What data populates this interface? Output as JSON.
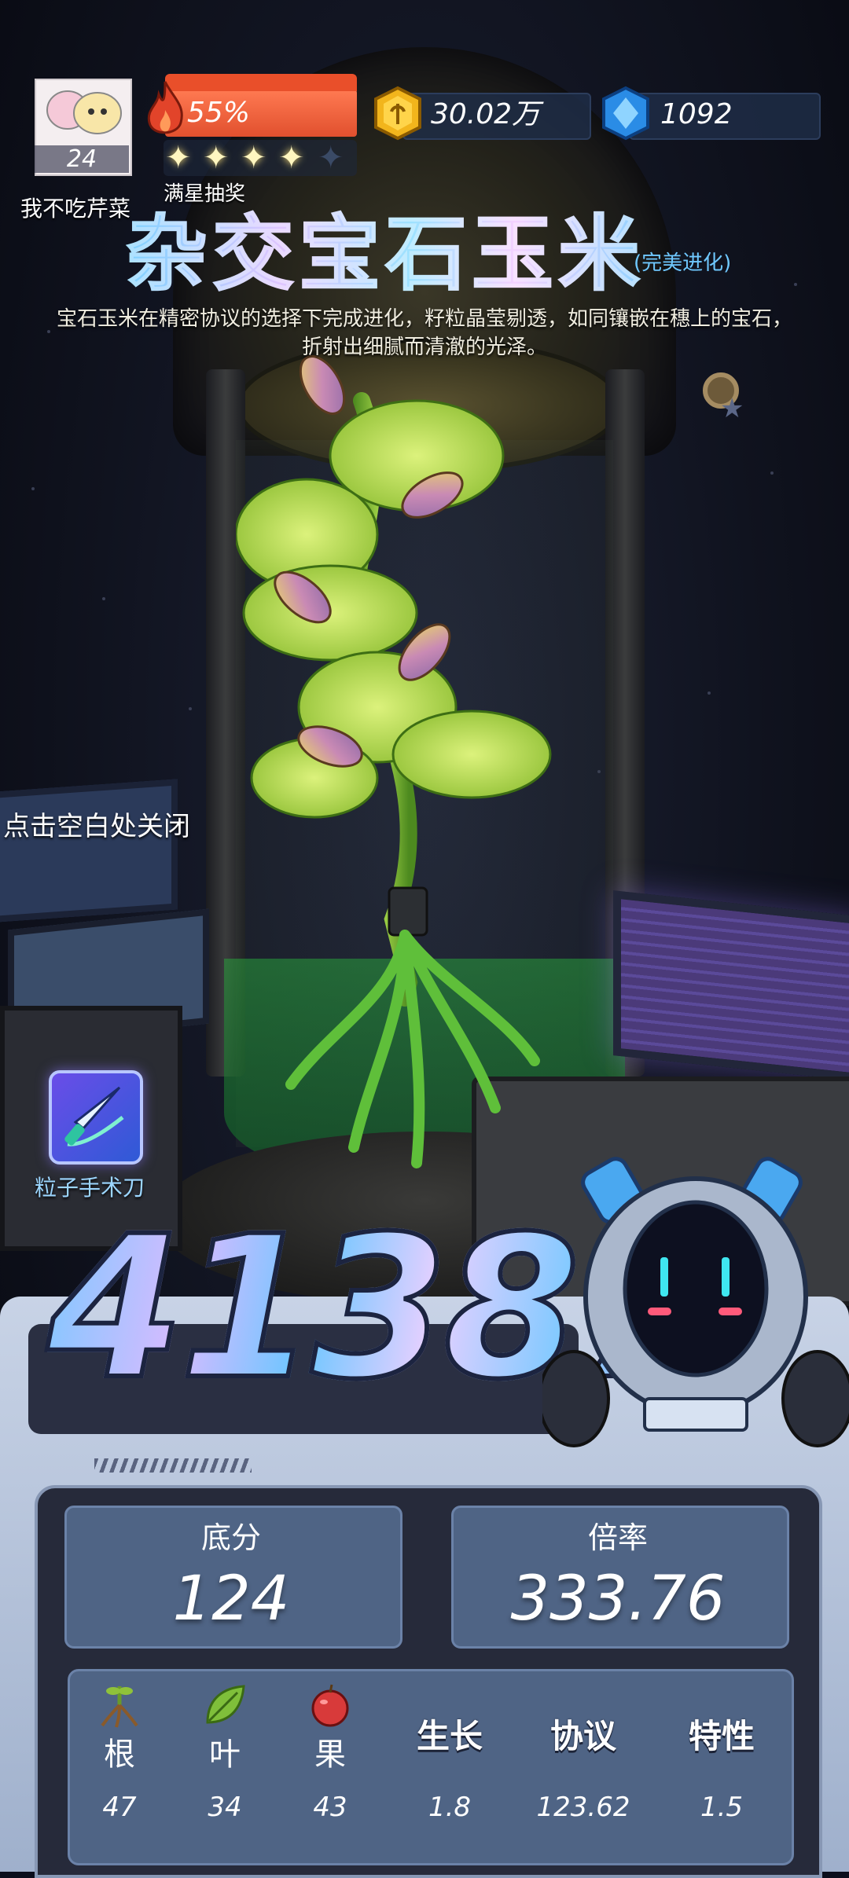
{
  "player": {
    "name": "我不吃芹菜",
    "level": "24"
  },
  "energy": {
    "percent_text": "55%",
    "fill": 0.55
  },
  "stars": {
    "filled": 4,
    "total": 5,
    "label": "满星抽奖",
    "glyph": "✦"
  },
  "currency": {
    "gold": "30.02万",
    "gems": "1092"
  },
  "title": {
    "main": "杂交宝石玉米",
    "tag": "(完美进化)"
  },
  "description": "宝石玉米在精密协议的选择下完成进化，籽粒晶莹剔透，如同镶嵌在穗上的宝石，折射出细腻而清澈的光泽。",
  "close_hint": "点击空白处关闭",
  "tool": {
    "label": "粒子手术刀",
    "icon": "scalpel-icon"
  },
  "score": "41387",
  "stats": {
    "base": {
      "label": "底分",
      "value": "124"
    },
    "multiplier": {
      "label": "倍率",
      "value": "333.76"
    }
  },
  "attributes": {
    "root": {
      "label": "根",
      "value": "47",
      "icon": "root-icon"
    },
    "leaf": {
      "label": "叶",
      "value": "34",
      "icon": "leaf-icon"
    },
    "fruit": {
      "label": "果",
      "value": "43",
      "icon": "fruit-icon"
    },
    "growth": {
      "label": "生长",
      "value": "1.8"
    },
    "protocol": {
      "label": "协议",
      "value": "123.62"
    },
    "trait": {
      "label": "特性",
      "value": "1.5"
    }
  },
  "colors": {
    "accent_blue": "#6fc8ff",
    "energy_red": "#e94f2a",
    "panel": "#4f6485"
  }
}
